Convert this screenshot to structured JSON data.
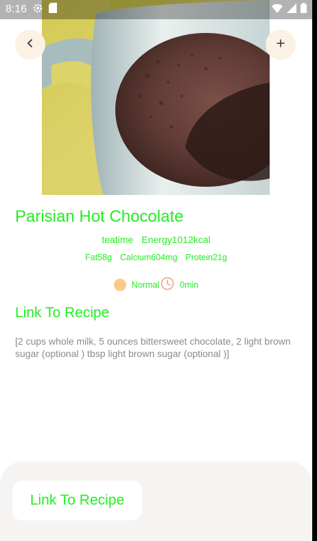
{
  "status_bar": {
    "time": "8:16",
    "icons": [
      "settings-gear-icon",
      "sd-card-icon",
      "wifi-icon",
      "signal-icon",
      "battery-icon"
    ]
  },
  "header": {
    "back_icon": "chevron-left-icon",
    "add_icon": "plus-icon"
  },
  "recipe": {
    "title": "Parisian Hot Chocolate",
    "meal_type": "teatime",
    "energy": "Energy1012kcal",
    "fat": "Fat58g",
    "calcium": "Calcium604mg",
    "protein": "Protein21g",
    "difficulty": "Normal",
    "time": "0min",
    "link_heading": "Link To Recipe",
    "ingredients": "[2 cups whole milk, 5 ounces bittersweet chocolate, 2 light brown sugar (optional ) tbsp light brown sugar (optional )]"
  },
  "bottom": {
    "button_label": "Link To Recipe"
  },
  "colors": {
    "accent_green": "#22ee22",
    "button_bg": "#fbf1e4",
    "difficulty_dot": "#fbc98a",
    "clock_icon": "#f0a08a",
    "body_text": "#8a8a8a",
    "sheet_bg": "#f6f4f2"
  }
}
